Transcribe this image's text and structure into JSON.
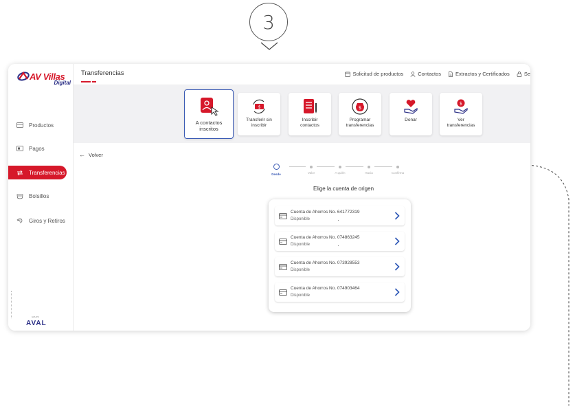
{
  "step": {
    "number": "3"
  },
  "sidebar": {
    "items": [
      {
        "label": "Productos",
        "icon": "products-icon",
        "active": false
      },
      {
        "label": "Pagos",
        "icon": "payments-icon",
        "active": false
      },
      {
        "label": "Transferencias",
        "icon": "transfer-icon",
        "active": true
      },
      {
        "label": "Bolsillos",
        "icon": "pocket-icon",
        "active": false
      },
      {
        "label": "Giros y Retiros",
        "icon": "withdraw-icon",
        "active": false
      }
    ],
    "footer_brand": "AVAL",
    "footer_sub": "GRUPO"
  },
  "logo": {
    "name": "AV Villas",
    "sub": "Digital"
  },
  "header": {
    "title": "Transferencias",
    "links": [
      {
        "label": "Solicitud de productos",
        "icon": "request-icon"
      },
      {
        "label": "Contactos",
        "icon": "contacts-icon"
      },
      {
        "label": "Extractos y Certificados",
        "icon": "document-icon"
      },
      {
        "label": "Se",
        "icon": "lock-icon"
      }
    ]
  },
  "options": [
    {
      "label": "A contactos\ninscritos",
      "icon": "contacts-transfer-icon",
      "selected": true
    },
    {
      "label": "Transferir sin\ninscribir",
      "icon": "cash-transfer-icon",
      "selected": false
    },
    {
      "label": "Inscribir\ncontactos",
      "icon": "register-list-icon",
      "selected": false
    },
    {
      "label": "Programar\ntransferencias",
      "icon": "schedule-money-icon",
      "selected": false
    },
    {
      "label": "Donar",
      "icon": "heart-hand-icon",
      "selected": false
    },
    {
      "label": "Ver\ntransferencias",
      "icon": "coin-hand-icon",
      "selected": false
    }
  ],
  "back_label": "Volver",
  "stepper": {
    "steps": [
      "Desde",
      "Valor",
      "A quién",
      "Hacia",
      "Confirma"
    ],
    "active_index": 0
  },
  "choose_title": "Elige la cuenta de origen",
  "accounts": [
    {
      "name": "Cuenta de Ahorros No. 641772319",
      "status": "Disponible"
    },
    {
      "name": "Cuenta de Ahorros No. 074863245",
      "status": "Disponible"
    },
    {
      "name": "Cuenta de Ahorros No. 073928553",
      "status": "Disponible"
    },
    {
      "name": "Cuenta de Ahorros No. 074903464",
      "status": "Disponible"
    }
  ],
  "colors": {
    "brand_red": "#d6182a",
    "brand_blue": "#2b2f86",
    "accent_blue": "#3b5bb5"
  }
}
